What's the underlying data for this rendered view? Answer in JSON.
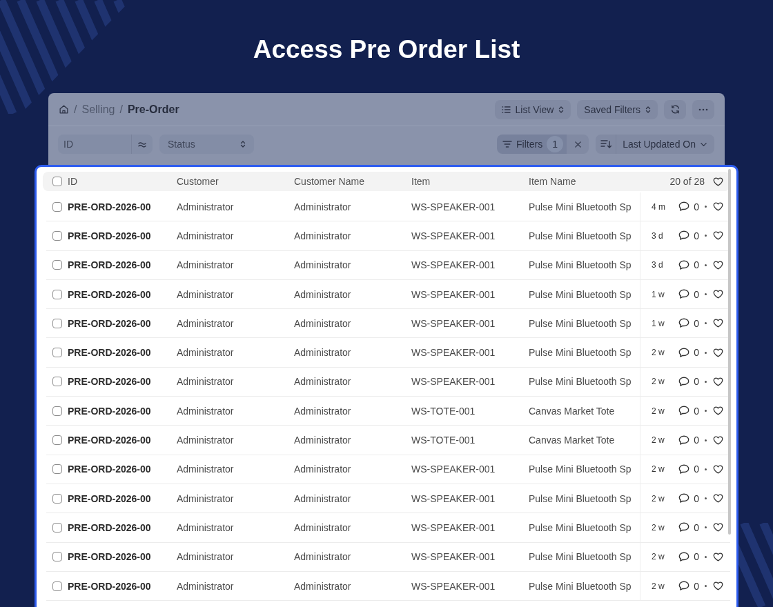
{
  "page": {
    "title": "Access Pre Order List"
  },
  "toolbar": {
    "breadcrumb": [
      {
        "separator": "/",
        "label": "Selling"
      },
      {
        "separator": "/",
        "label": "Pre-Order"
      }
    ],
    "view_button": "List View",
    "saved_filters_button": "Saved Filters"
  },
  "filters": {
    "id_field": {
      "placeholder": "ID"
    },
    "status_field": {
      "placeholder": "Status"
    },
    "filters_button": {
      "label": "Filters",
      "count": "1"
    },
    "sort_button": {
      "label": "Last Updated On"
    }
  },
  "table": {
    "header_checked": false,
    "columns": [
      "ID",
      "Customer",
      "Customer Name",
      "Item",
      "Item Name"
    ],
    "count": "20 of 28",
    "rows": [
      {
        "checked": false,
        "id": "PRE-ORD-2026-00",
        "customer": "Administrator",
        "customer_name": "Administrator",
        "item": "WS-SPEAKER-001",
        "item_name": "Pulse Mini Bluetooth Sp",
        "modified": "4 m",
        "comments": "0",
        "liked": false
      },
      {
        "checked": false,
        "id": "PRE-ORD-2026-00",
        "customer": "Administrator",
        "customer_name": "Administrator",
        "item": "WS-SPEAKER-001",
        "item_name": "Pulse Mini Bluetooth Sp",
        "modified": "3 d",
        "comments": "0",
        "liked": false
      },
      {
        "checked": false,
        "id": "PRE-ORD-2026-00",
        "customer": "Administrator",
        "customer_name": "Administrator",
        "item": "WS-SPEAKER-001",
        "item_name": "Pulse Mini Bluetooth Sp",
        "modified": "3 d",
        "comments": "0",
        "liked": false
      },
      {
        "checked": false,
        "id": "PRE-ORD-2026-00",
        "customer": "Administrator",
        "customer_name": "Administrator",
        "item": "WS-SPEAKER-001",
        "item_name": "Pulse Mini Bluetooth Sp",
        "modified": "1 w",
        "comments": "0",
        "liked": false
      },
      {
        "checked": false,
        "id": "PRE-ORD-2026-00",
        "customer": "Administrator",
        "customer_name": "Administrator",
        "item": "WS-SPEAKER-001",
        "item_name": "Pulse Mini Bluetooth Sp",
        "modified": "1 w",
        "comments": "0",
        "liked": false
      },
      {
        "checked": false,
        "id": "PRE-ORD-2026-00",
        "customer": "Administrator",
        "customer_name": "Administrator",
        "item": "WS-SPEAKER-001",
        "item_name": "Pulse Mini Bluetooth Sp",
        "modified": "2 w",
        "comments": "0",
        "liked": false
      },
      {
        "checked": false,
        "id": "PRE-ORD-2026-00",
        "customer": "Administrator",
        "customer_name": "Administrator",
        "item": "WS-SPEAKER-001",
        "item_name": "Pulse Mini Bluetooth Sp",
        "modified": "2 w",
        "comments": "0",
        "liked": false
      },
      {
        "checked": false,
        "id": "PRE-ORD-2026-00",
        "customer": "Administrator",
        "customer_name": "Administrator",
        "item": "WS-TOTE-001",
        "item_name": "Canvas Market Tote",
        "modified": "2 w",
        "comments": "0",
        "liked": false
      },
      {
        "checked": false,
        "id": "PRE-ORD-2026-00",
        "customer": "Administrator",
        "customer_name": "Administrator",
        "item": "WS-TOTE-001",
        "item_name": "Canvas Market Tote",
        "modified": "2 w",
        "comments": "0",
        "liked": false
      },
      {
        "checked": false,
        "id": "PRE-ORD-2026-00",
        "customer": "Administrator",
        "customer_name": "Administrator",
        "item": "WS-SPEAKER-001",
        "item_name": "Pulse Mini Bluetooth Sp",
        "modified": "2 w",
        "comments": "0",
        "liked": false
      },
      {
        "checked": false,
        "id": "PRE-ORD-2026-00",
        "customer": "Administrator",
        "customer_name": "Administrator",
        "item": "WS-SPEAKER-001",
        "item_name": "Pulse Mini Bluetooth Sp",
        "modified": "2 w",
        "comments": "0",
        "liked": false
      },
      {
        "checked": false,
        "id": "PRE-ORD-2026-00",
        "customer": "Administrator",
        "customer_name": "Administrator",
        "item": "WS-SPEAKER-001",
        "item_name": "Pulse Mini Bluetooth Sp",
        "modified": "2 w",
        "comments": "0",
        "liked": false
      },
      {
        "checked": false,
        "id": "PRE-ORD-2026-00",
        "customer": "Administrator",
        "customer_name": "Administrator",
        "item": "WS-SPEAKER-001",
        "item_name": "Pulse Mini Bluetooth Sp",
        "modified": "2 w",
        "comments": "0",
        "liked": false
      },
      {
        "checked": false,
        "id": "PRE-ORD-2026-00",
        "customer": "Administrator",
        "customer_name": "Administrator",
        "item": "WS-SPEAKER-001",
        "item_name": "Pulse Mini Bluetooth Sp",
        "modified": "2 w",
        "comments": "0",
        "liked": false
      }
    ]
  }
}
